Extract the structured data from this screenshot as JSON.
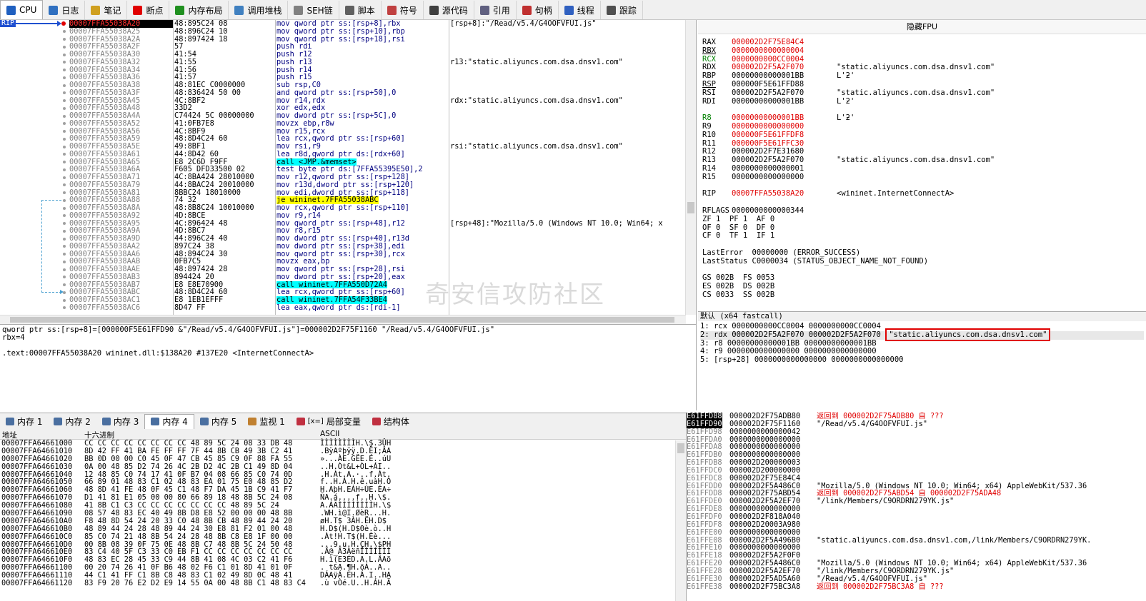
{
  "tabs": [
    {
      "label": "CPU",
      "icon": "cpu-icon",
      "color": "#2060c0"
    },
    {
      "label": "日志",
      "icon": "log-icon",
      "color": "#3070c0"
    },
    {
      "label": "笔记",
      "icon": "notes-icon",
      "color": "#d0a020"
    },
    {
      "label": "断点",
      "icon": "breakpoint-icon",
      "color": "#e00000"
    },
    {
      "label": "内存布局",
      "icon": "memory-map-icon",
      "color": "#209020"
    },
    {
      "label": "调用堆栈",
      "icon": "callstack-icon",
      "color": "#4080c0"
    },
    {
      "label": "SEH链",
      "icon": "seh-icon",
      "color": "#808080"
    },
    {
      "label": "脚本",
      "icon": "script-icon",
      "color": "#606060"
    },
    {
      "label": "符号",
      "icon": "symbols-icon",
      "color": "#c04040"
    },
    {
      "label": "源代码",
      "icon": "source-icon",
      "color": "#404040"
    },
    {
      "label": "引用",
      "icon": "references-icon",
      "color": "#606080"
    },
    {
      "label": "句柄",
      "icon": "handles-icon",
      "color": "#c03030"
    },
    {
      "label": "线程",
      "icon": "threads-icon",
      "color": "#3060c0"
    },
    {
      "label": "跟踪",
      "icon": "trace-icon",
      "color": "#505050"
    }
  ],
  "rip_label": "RIP",
  "disasm": [
    {
      "addr": "00007FFA55038A20",
      "bytes": "48:895C24 08",
      "ins": "mov qword ptr ss:[rsp+8],rbx",
      "cmt": "[rsp+8]:\"/Read/v5.4/G4OOFVFUI.js\"",
      "cur": true
    },
    {
      "addr": "00007FFA55038A25",
      "bytes": "48:896C24 10",
      "ins": "mov qword ptr ss:[rsp+10],rbp",
      "cmt": ""
    },
    {
      "addr": "00007FFA55038A2A",
      "bytes": "48:897424 18",
      "ins": "mov qword ptr ss:[rsp+18],rsi",
      "cmt": ""
    },
    {
      "addr": "00007FFA55038A2F",
      "bytes": "57",
      "ins": "push rdi",
      "cmt": ""
    },
    {
      "addr": "00007FFA55038A30",
      "bytes": "41:54",
      "ins": "push r12",
      "cmt": ""
    },
    {
      "addr": "00007FFA55038A32",
      "bytes": "41:55",
      "ins": "push r13",
      "cmt": "r13:\"static.aliyuncs.com.dsa.dnsv1.com\""
    },
    {
      "addr": "00007FFA55038A34",
      "bytes": "41:56",
      "ins": "push r14",
      "cmt": ""
    },
    {
      "addr": "00007FFA55038A36",
      "bytes": "41:57",
      "ins": "push r15",
      "cmt": ""
    },
    {
      "addr": "00007FFA55038A38",
      "bytes": "48:81EC C0000000",
      "ins": "sub rsp,C0",
      "cmt": ""
    },
    {
      "addr": "00007FFA55038A3F",
      "bytes": "48:836424 50 00",
      "ins": "and qword ptr ss:[rsp+50],0",
      "cmt": ""
    },
    {
      "addr": "00007FFA55038A45",
      "bytes": "4C:8BF2",
      "ins": "mov r14,rdx",
      "cmt": "rdx:\"static.aliyuncs.com.dsa.dnsv1.com\""
    },
    {
      "addr": "00007FFA55038A48",
      "bytes": "33D2",
      "ins": "xor edx,edx",
      "cmt": ""
    },
    {
      "addr": "00007FFA55038A4A",
      "bytes": "C74424 5C 00000000",
      "ins": "mov dword ptr ss:[rsp+5C],0",
      "cmt": ""
    },
    {
      "addr": "00007FFA55038A52",
      "bytes": "41:0FB7E8",
      "ins": "movzx ebp,r8w",
      "cmt": ""
    },
    {
      "addr": "00007FFA55038A56",
      "bytes": "4C:8BF9",
      "ins": "mov r15,rcx",
      "cmt": ""
    },
    {
      "addr": "00007FFA55038A59",
      "bytes": "48:8D4C24 60",
      "ins": "lea rcx,qword ptr ss:[rsp+60]",
      "cmt": ""
    },
    {
      "addr": "00007FFA55038A5E",
      "bytes": "49:8BF1",
      "ins": "mov rsi,r9",
      "cmt": "rsi:\"static.aliyuncs.com.dsa.dnsv1.com\""
    },
    {
      "addr": "00007FFA55038A61",
      "bytes": "44:8D42 60",
      "ins": "lea r8d,qword ptr ds:[rdx+60]",
      "cmt": ""
    },
    {
      "addr": "00007FFA55038A65",
      "bytes": "E8 2C6D F9FF",
      "ins": "call <JMP.&memset>",
      "cmt": "",
      "hl": "call"
    },
    {
      "addr": "00007FFA55038A6A",
      "bytes": "F605 DFD33500 02",
      "ins": "test byte ptr ds:[7FFA55395E50],2",
      "cmt": ""
    },
    {
      "addr": "00007FFA55038A71",
      "bytes": "4C:8BA424 28010000",
      "ins": "mov r12,qword ptr ss:[rsp+128]",
      "cmt": ""
    },
    {
      "addr": "00007FFA55038A79",
      "bytes": "44:8BAC24 20010000",
      "ins": "mov r13d,dword ptr ss:[rsp+120]",
      "cmt": ""
    },
    {
      "addr": "00007FFA55038A81",
      "bytes": "8BBC24 18010000",
      "ins": "mov edi,dword ptr ss:[rsp+118]",
      "cmt": ""
    },
    {
      "addr": "00007FFA55038A88",
      "bytes": "74 32",
      "ins": "je wininet.7FFA55038ABC",
      "cmt": "",
      "hl": "jmp"
    },
    {
      "addr": "00007FFA55038A8A",
      "bytes": "48:8B8C24 10010000",
      "ins": "mov rcx,qword ptr ss:[rsp+110]",
      "cmt": ""
    },
    {
      "addr": "00007FFA55038A92",
      "bytes": "4D:8BCE",
      "ins": "mov r9,r14",
      "cmt": ""
    },
    {
      "addr": "00007FFA55038A95",
      "bytes": "4C:896424 48",
      "ins": "mov qword ptr ss:[rsp+48],r12",
      "cmt": "[rsp+48]:\"Mozilla/5.0 (Windows NT 10.0; Win64; x"
    },
    {
      "addr": "00007FFA55038A9A",
      "bytes": "4D:8BC7",
      "ins": "mov r8,r15",
      "cmt": ""
    },
    {
      "addr": "00007FFA55038A9D",
      "bytes": "44:896C24 40",
      "ins": "mov dword ptr ss:[rsp+40],r13d",
      "cmt": ""
    },
    {
      "addr": "00007FFA55038AA2",
      "bytes": "897C24 38",
      "ins": "mov dword ptr ss:[rsp+38],edi",
      "cmt": ""
    },
    {
      "addr": "00007FFA55038AA6",
      "bytes": "48:894C24 30",
      "ins": "mov qword ptr ss:[rsp+30],rcx",
      "cmt": ""
    },
    {
      "addr": "00007FFA55038AAB",
      "bytes": "0FB7C5",
      "ins": "movzx eax,bp",
      "cmt": ""
    },
    {
      "addr": "00007FFA55038AAE",
      "bytes": "48:897424 28",
      "ins": "mov qword ptr ss:[rsp+28],rsi",
      "cmt": ""
    },
    {
      "addr": "00007FFA55038AB3",
      "bytes": "894424 20",
      "ins": "mov dword ptr ss:[rsp+20],eax",
      "cmt": ""
    },
    {
      "addr": "00007FFA55038AB7",
      "bytes": "E8 E8E70900",
      "ins": "call wininet.7FFA550D72A4",
      "cmt": "",
      "hl": "call"
    },
    {
      "addr": "00007FFA55038ABC",
      "bytes": "48:8D4C24 60",
      "ins": "lea rcx,qword ptr ss:[rsp+60]",
      "cmt": ""
    },
    {
      "addr": "00007FFA55038AC1",
      "bytes": "E8 1EB1EFFF",
      "ins": "call wininet.7FFA54F33BE4",
      "cmt": "",
      "hl": "call"
    },
    {
      "addr": "00007FFA55038AC6",
      "bytes": "8D47 FF",
      "ins": "lea eax,qword ptr ds:[rdi-1]",
      "cmt": ""
    }
  ],
  "info_lines": [
    "qword ptr ss:[rsp+8]=[000000F5E61FFD90 &\"/Read/v5.4/G4OOFVFUI.js\"]=000002D2F75F1160 \"/Read/v5.4/G4OOFVFUI.js\"",
    "rbx=4",
    "",
    ".text:00007FFA55038A20 wininet.dll:$138A20 #137E20 <InternetConnectA>"
  ],
  "regs_header": "隐藏FPU",
  "registers": [
    {
      "n": "RAX",
      "v": "000002D2F75E84C4",
      "c": "",
      "red": true
    },
    {
      "n": "RBX",
      "v": "0000000000000004",
      "c": "",
      "red": true
    },
    {
      "n": "RCX",
      "v": "0000000000CC0004",
      "c": "",
      "red": true
    },
    {
      "n": "RDX",
      "v": "000002D2F5A2F070",
      "c": "\"static.aliyuncs.com.dsa.dnsv1.com\"",
      "red": true
    },
    {
      "n": "RBP",
      "v": "00000000000001BB",
      "c": "L'ƻ'",
      "red": false
    },
    {
      "n": "RSP",
      "v": "000000F5E61FFD88",
      "c": "",
      "red": false
    },
    {
      "n": "RSI",
      "v": "000002D2F5A2F070",
      "c": "\"static.aliyuncs.com.dsa.dnsv1.com\"",
      "red": false
    },
    {
      "n": "RDI",
      "v": "00000000000001BB",
      "c": "L'ƻ'",
      "red": false
    },
    {
      "n": "",
      "v": "",
      "c": "",
      "red": false
    },
    {
      "n": "R8",
      "v": "00000000000001BB",
      "c": "L'ƻ'",
      "red": true
    },
    {
      "n": "R9",
      "v": "0000000000000000",
      "c": "",
      "red": true
    },
    {
      "n": "R10",
      "v": "000000F5E61FFDF8",
      "c": "",
      "red": true
    },
    {
      "n": "R11",
      "v": "000000F5E61FFC30",
      "c": "",
      "red": true
    },
    {
      "n": "R12",
      "v": "000002D2F7E31680",
      "c": "",
      "red": false
    },
    {
      "n": "R13",
      "v": "000002D2F5A2F070",
      "c": "\"static.aliyuncs.com.dsa.dnsv1.com\"",
      "red": false
    },
    {
      "n": "R14",
      "v": "0000000000000001",
      "c": "",
      "red": false
    },
    {
      "n": "R15",
      "v": "0000000000000000",
      "c": "",
      "red": false
    },
    {
      "n": "",
      "v": "",
      "c": "",
      "red": false
    },
    {
      "n": "RIP",
      "v": "00007FFA55038A20",
      "c": "<wininet.InternetConnectA>",
      "red": true
    },
    {
      "n": "",
      "v": "",
      "c": "",
      "red": false
    },
    {
      "n": "RFLAGS",
      "v": "0000000000000344",
      "c": "",
      "red": false
    },
    {
      "n": "",
      "v": "ZF 1  PF 1  AF 0",
      "c": "",
      "red": false
    },
    {
      "n": "",
      "v": "OF 0  SF 0  DF 0",
      "c": "",
      "red": false
    },
    {
      "n": "",
      "v": "CF 0  TF 1  IF 1",
      "c": "",
      "red": false
    },
    {
      "n": "",
      "v": "",
      "c": "",
      "red": false
    },
    {
      "n": "",
      "v": "LastError  00000000 (ERROR_SUCCESS)",
      "c": "",
      "red": false
    },
    {
      "n": "",
      "v": "LastStatus C0000034 (STATUS_OBJECT_NAME_NOT_FOUND)",
      "c": "",
      "red": false
    },
    {
      "n": "",
      "v": "",
      "c": "",
      "red": false
    },
    {
      "n": "",
      "v": "GS 002B  FS 0053",
      "c": "",
      "red": false
    },
    {
      "n": "",
      "v": "ES 002B  DS 002B",
      "c": "",
      "red": false
    },
    {
      "n": "",
      "v": "CS 0033  SS 002B",
      "c": "",
      "red": false
    }
  ],
  "args_header": "默认 (x64 fastcall)",
  "args": [
    {
      "t": "1: rcx 0000000000CC0004 0000000000CC0004",
      "x": ""
    },
    {
      "t": "2: rdx 000002D2F5A2F070 000002D2F5A2F070 ",
      "x": "\"static.aliyuncs.com.dsa.dnsv1.com\""
    },
    {
      "t": "3: r8 00000000000001BB 00000000000001BB",
      "x": ""
    },
    {
      "t": "4: r9 0000000000000000 0000000000000000",
      "x": ""
    },
    {
      "t": "5: [rsp+28] 0000000000000000 0000000000000000",
      "x": ""
    }
  ],
  "bottom_tabs": [
    {
      "label": "内存 1",
      "icon": "memory-icon"
    },
    {
      "label": "内存 2",
      "icon": "memory-icon"
    },
    {
      "label": "内存 3",
      "icon": "memory-icon"
    },
    {
      "label": "内存 4",
      "icon": "memory-icon",
      "active": true
    },
    {
      "label": "内存 5",
      "icon": "memory-icon"
    },
    {
      "label": "监视 1",
      "icon": "watch-icon"
    },
    {
      "label": "局部变量",
      "icon": "locals-icon",
      "prefix": "[x=]"
    },
    {
      "label": "结构体",
      "icon": "struct-icon"
    }
  ],
  "dump_head": {
    "addr": "地址",
    "hex": "十六进制",
    "ascii": "ASCII"
  },
  "dump": [
    {
      "a": "00007FFA64661000",
      "h": "CC CC CC CC CC CC CC CC 48 89 5C 24 08 33 DB 48",
      "s": "ÌÌÌÌÌÌÌÌH.\\$.3ÛH"
    },
    {
      "a": "00007FFA64661010",
      "h": "8D 42 FF 41 BA FE FF FF 7F 44 8B CB 49 3B C2 41",
      "s": ".BÿAºþÿÿ.D.ËI;ÂA"
    },
    {
      "a": "00007FFA64661020",
      "h": "BB 0D 00 00 C0 45 0F 47 CB 45 85 C9 0F 88 FA 55",
      "s": "»...ÀE.GËE.É..úU"
    },
    {
      "a": "00007FFA64661030",
      "h": "0A 00 48 85 D2 74 26 4C 2B D2 4C 2B C1 49 8D 04",
      "s": "..H.Òt&L+ÒL+ÁI.."
    },
    {
      "a": "00007FFA64661040",
      "h": "12 48 85 C0 74 17 41 0F B7 04 08 66 85 C0 74 0D",
      "s": ".H.Àt.A.·..f.Àt."
    },
    {
      "a": "00007FFA64661050",
      "h": "66 89 01 48 83 C1 02 48 83 EA 01 75 E0 48 85 D2",
      "s": "f..H.Á.H.ê.uàH.Ò"
    },
    {
      "a": "00007FFA64661060",
      "h": "48 8D 41 FE 48 0F 45 C1 48 F7 DA 45 1B C9 41 F7",
      "s": "H.AþH.EÁH÷ÚE.ÉA÷"
    },
    {
      "a": "00007FFA64661070",
      "h": "D1 41 81 E1 05 00 00 80 66 89 18 48 8B 5C 24 08",
      "s": "ÑA.á....f..H.\\$."
    },
    {
      "a": "00007FFA64661080",
      "h": "41 8B C1 C3 CC CC CC CC CC CC CC 48 89 5C 24",
      "s": "A.ÁÃÌÌÌÌÌÌÌÌH.\\$"
    },
    {
      "a": "00007FFA64661090",
      "h": "08 57 48 83 EC 40 49 8B D8 E8 52 00 00 00 48 8B",
      "s": ".WH.ì@I.ØèR...H."
    },
    {
      "a": "00007FFA646610A0",
      "h": "F8 48 8D 54 24 20 33 C0 48 8B CB 48 89 44 24 20",
      "s": "øH.T$ 3ÀH.ËH.D$ "
    },
    {
      "a": "00007FFA646610B0",
      "h": "48 89 44 24 28 48 89 44 24 30 E8 81 F2 01 00 48",
      "s": "H.D$(H.D$0è.ò..H"
    },
    {
      "a": "00007FFA646610C0",
      "h": "85 C0 74 21 48 8B 54 24 28 48 8B C8 E8 1F 00 00",
      "s": ".Àt!H.T$(H.Èè..."
    },
    {
      "a": "00007FFA646610D0",
      "h": "00 8B 08 39 0F 75 0E 48 8B C7 48 8B 5C 24 50 48",
      "s": "...9.u.H.ÇH.\\$PH"
    },
    {
      "a": "00007FFA646610E0",
      "h": "83 C4 40 5F C3 33 C0 EB F1 CC CC CC CC CC CC CC",
      "s": ".Ä@_Ã3ÀëñÌÌÌÌÌÌÌ"
    },
    {
      "a": "00007FFA646610F0",
      "h": "48 83 EC 28 45 33 C9 44 8B 41 08 4C 03 C2 41 F6",
      "s": "H.ì(E3ÉD.A.L.ÂAö"
    },
    {
      "a": "00007FFA64661100",
      "h": "00 20 74 26 41 0F B6 48 02 F6 C1 01 8D 41 01 0F",
      "s": ". t&A.¶H.öÁ..A.."
    },
    {
      "a": "00007FFA64661110",
      "h": "44 C1 41 FF C1 8B C8 48 83 C1 02 49 8D 0C 48 41",
      "s": "DÁAÿÁ.ÈH.Á.I..HA"
    },
    {
      "a": "00007FFA64661120",
      "h": "83 F9 20 76 E2 D2 E9 14 55 0A 00 48 8B C1 48 83 C4",
      "s": ".ù vÒé.U..H.ÁH.Ä"
    }
  ],
  "stack": [
    {
      "a": "E61FFD88",
      "v": "000002D2F75ADB80",
      "c": "返回到 000002D2F75ADB80 自 ???",
      "red": true,
      "cur": true
    },
    {
      "a": "E61FFD90",
      "v": "000002D2F75F1160",
      "c": "\"/Read/v5.4/G4OOFVFUI.js\"",
      "red": false,
      "cur": true
    },
    {
      "a": "E61FFD98",
      "v": "0000000000000042",
      "c": "",
      "red": false
    },
    {
      "a": "E61FFDA0",
      "v": "0000000000000000",
      "c": "",
      "red": false
    },
    {
      "a": "E61FFDA8",
      "v": "0000000000000000",
      "c": "",
      "red": false
    },
    {
      "a": "E61FFDB0",
      "v": "0000000000000000",
      "c": "",
      "red": false
    },
    {
      "a": "E61FFDB8",
      "v": "000002D200000003",
      "c": "",
      "red": false
    },
    {
      "a": "E61FFDC0",
      "v": "000002D200000000",
      "c": "",
      "red": false
    },
    {
      "a": "E61FFDC8",
      "v": "000002D2F75E84C4",
      "c": "",
      "red": false
    },
    {
      "a": "E61FFDD0",
      "v": "000002D2F5A486C0",
      "c": "\"Mozilla/5.0 (Windows NT 10.0; Win64; x64) AppleWebKit/537.36",
      "red": false
    },
    {
      "a": "E61FFDD8",
      "v": "000002D2F75ABD54",
      "c": "返回到 000002D2F75ABD54 自 000002D2F75ADA48",
      "red": true
    },
    {
      "a": "E61FFDE0",
      "v": "000002D2F5A2EF70",
      "c": "\"/link/Members/C9ORDRN279YK.js\"",
      "red": false
    },
    {
      "a": "E61FFDE8",
      "v": "0000000000000000",
      "c": "",
      "red": false
    },
    {
      "a": "E61FFDF0",
      "v": "000002D2F818A040",
      "c": "",
      "red": false
    },
    {
      "a": "E61FFDF8",
      "v": "000002D20003A980",
      "c": "",
      "red": false
    },
    {
      "a": "E61FFE00",
      "v": "0000000000000000",
      "c": "",
      "red": false
    },
    {
      "a": "E61FFE08",
      "v": "000002D2F5A496B0",
      "c": "\"static.aliyuncs.com.dsa.dnsv1.com,/link/Members/C9ORDRN279YK.",
      "red": false
    },
    {
      "a": "E61FFE10",
      "v": "0000000000000000",
      "c": "",
      "red": false
    },
    {
      "a": "E61FFE18",
      "v": "000002D2F5A2F0F0",
      "c": "",
      "red": false
    },
    {
      "a": "E61FFE20",
      "v": "000002D2F5A486C0",
      "c": "\"Mozilla/5.0 (Windows NT 10.0; Win64; x64) AppleWebKit/537.36",
      "red": false
    },
    {
      "a": "E61FFE28",
      "v": "000002D2F5A2EF70",
      "c": "\"/link/Members/C9ORDRN279YK.js\"",
      "red": false
    },
    {
      "a": "E61FFE30",
      "v": "000002D2F5AD5A60",
      "c": "\"/Read/v5.4/G4OOFVFUI.js\"",
      "red": false
    },
    {
      "a": "E61FFE38",
      "v": "000002D2F75BC3A8",
      "c": "返回到 000002D2F75BC3A8 自 ???",
      "red": true
    }
  ],
  "watermark": "奇安信攻防社区"
}
